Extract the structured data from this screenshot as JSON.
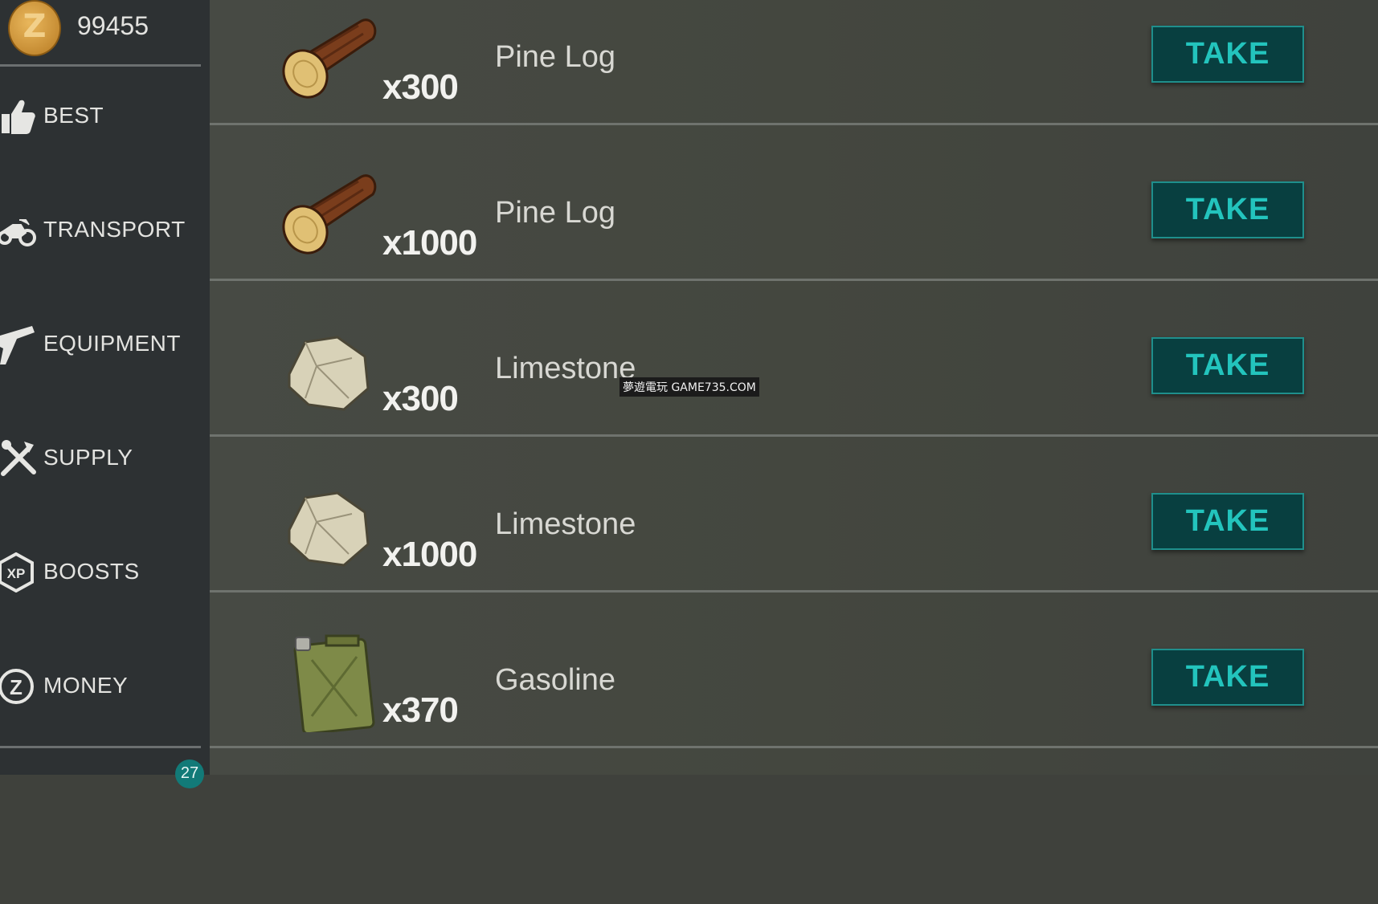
{
  "balance": {
    "value": "99455",
    "currency_icon": "coin-icon"
  },
  "sidebar": {
    "items": [
      {
        "label": "BEST",
        "icon": "thumbs-up-icon"
      },
      {
        "label": "TRANSPORT",
        "icon": "motorcycle-icon"
      },
      {
        "label": "EQUIPMENT",
        "icon": "pistol-icon"
      },
      {
        "label": "SUPPLY",
        "icon": "crossed-tools-icon"
      },
      {
        "label": "BOOSTS",
        "icon": "xp-hexagon-icon"
      },
      {
        "label": "MONEY",
        "icon": "coin-outline-icon"
      }
    ],
    "badge": "27"
  },
  "offers": [
    {
      "name": "Pine Log",
      "quantity": "x300",
      "icon": "pine-log-icon",
      "action": "TAKE"
    },
    {
      "name": "Pine Log",
      "quantity": "x1000",
      "icon": "pine-log-icon",
      "action": "TAKE"
    },
    {
      "name": "Limestone",
      "quantity": "x300",
      "icon": "limestone-icon",
      "action": "TAKE"
    },
    {
      "name": "Limestone",
      "quantity": "x1000",
      "icon": "limestone-icon",
      "action": "TAKE"
    },
    {
      "name": "Gasoline",
      "quantity": "x370",
      "icon": "gasoline-canister-icon",
      "action": "TAKE"
    }
  ],
  "watermark": "夢遊電玩 GAME735.COM",
  "colors": {
    "take_button_bg": "#083f40",
    "take_button_text": "#23c4bd",
    "sidebar_bg": "#2d3133"
  }
}
